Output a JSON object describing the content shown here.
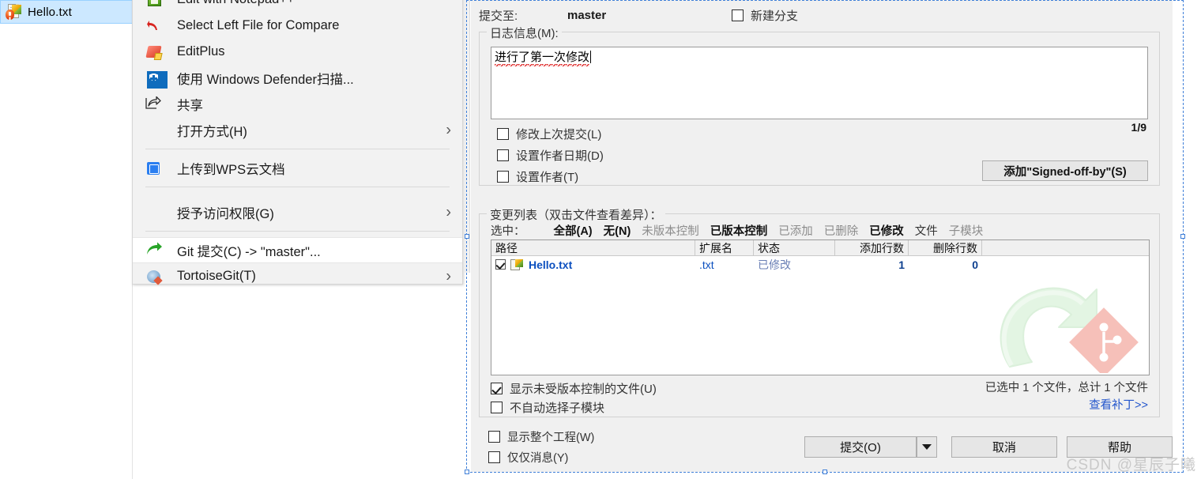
{
  "explorer": {
    "file": {
      "name": "Hello.txt",
      "icon": "text-file-modified-icon"
    }
  },
  "context_menu": {
    "items": [
      {
        "label": "Edit with Notepad++",
        "icon": "notepadpp-icon",
        "submenu": false,
        "highlighted": false,
        "clipped": "top"
      },
      {
        "label": "Select Left File for Compare",
        "icon": "compare-undo-icon",
        "submenu": false,
        "highlighted": false
      },
      {
        "label": "EditPlus",
        "icon": "editplus-icon",
        "submenu": false,
        "highlighted": false
      },
      {
        "label": "使用 Windows Defender扫描...",
        "icon": "defender-shield-icon",
        "submenu": false,
        "highlighted": false
      },
      {
        "label": "共享",
        "icon": "share-icon",
        "submenu": false,
        "highlighted": false
      },
      {
        "label": "打开方式(H)",
        "icon": "none",
        "submenu": true,
        "highlighted": false
      },
      {
        "label": "上传到WPS云文档",
        "icon": "wps-cloud-icon",
        "submenu": false,
        "highlighted": false
      },
      {
        "label": "授予访问权限(G)",
        "icon": "none",
        "submenu": true,
        "highlighted": false
      },
      {
        "label": "Git 提交(C) -> \"master\"...",
        "icon": "git-commit-arrow-icon",
        "submenu": false,
        "highlighted": true
      },
      {
        "label": "TortoiseGit(T)",
        "icon": "tortoisegit-icon",
        "submenu": true,
        "highlighted": false,
        "clipped": "bottom"
      }
    ]
  },
  "dialog": {
    "commit_to": {
      "label": "提交至:",
      "branch": "master",
      "new_branch_label": "新建分支",
      "new_branch_checked": false
    },
    "log_group": {
      "title": "日志信息(M):",
      "message": "进行了第一次修改",
      "counter": "1/9",
      "checkboxes": [
        {
          "label": "修改上次提交(L)",
          "checked": false
        },
        {
          "label": "设置作者日期(D)",
          "checked": false
        },
        {
          "label": "设置作者(T)",
          "checked": false
        }
      ],
      "signoff_button": "添加\"Signed-off-by\"(S)"
    },
    "changes_group": {
      "title": "变更列表（双击文件查看差异）：",
      "selection_label": "选中：",
      "filters": [
        {
          "label": "全部(A)",
          "state": "active"
        },
        {
          "label": "无(N)",
          "state": "active"
        },
        {
          "label": "未版本控制",
          "state": "dim"
        },
        {
          "label": "已版本控制",
          "state": "active"
        },
        {
          "label": "已添加",
          "state": "dim"
        },
        {
          "label": "已删除",
          "state": "dim"
        },
        {
          "label": "已修改",
          "state": "active"
        },
        {
          "label": "文件",
          "state": "dark"
        },
        {
          "label": "子模块",
          "state": "dim"
        }
      ],
      "table": {
        "columns": [
          "路径",
          "扩展名",
          "状态",
          "添加行数",
          "删除行数"
        ],
        "rows": [
          {
            "checked": true,
            "path": "Hello.txt",
            "ext": ".txt",
            "status": "已修改",
            "added": "1",
            "deleted": "0"
          }
        ]
      },
      "watermark_logo": "tortoisegit-logo",
      "below_checkboxes": [
        {
          "label": "显示未受版本控制的文件(U)",
          "checked": true
        },
        {
          "label": "不自动选择子模块",
          "checked": false
        }
      ],
      "selection_summary": "已选中 1 个文件，总计 1 个文件",
      "patch_link": "查看补丁>>"
    },
    "footer": {
      "checkboxes": [
        {
          "label": "显示整个工程(W)",
          "checked": false
        },
        {
          "label": "仅仅消息(Y)",
          "checked": false
        }
      ],
      "commit_button": "提交(O)",
      "commit_dropdown_icon": "chevron-down-icon",
      "cancel_button": "取消",
      "help_button": "帮助"
    }
  },
  "watermark": "CSDN @星辰子曦",
  "colors": {
    "selection_blue": "#cce8ff",
    "link_blue": "#2255cc",
    "marquee_blue": "#3f7fd8",
    "dialog_bg": "#f0f0f0",
    "menu_bg": "#f2f2f2"
  }
}
